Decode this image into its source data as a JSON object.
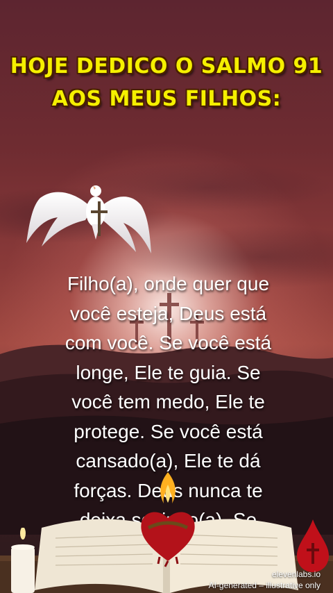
{
  "title": {
    "line1": "HOJE DEDICO O SALMO 91",
    "line2": "AOS MEUS FILHOS:"
  },
  "message": {
    "lines": [
      "Filho(a), onde quer que",
      "você esteja, Deus está",
      "com você. Se você está",
      "longe, Ele te guia. Se",
      "você tem medo, Ele te",
      "protege. Se você está",
      "cansado(a), Ele te dá",
      "forças. Deus nunca te",
      "deixa sozinho(a). Se"
    ]
  },
  "watermark": {
    "brand": "elevenlabs.io",
    "disclaimer": "AI-generated – illustrative only"
  },
  "colors": {
    "title_fill": "#f5f000",
    "title_outline": "#4a2000",
    "text": "#ffffff",
    "sky_top": "#5d2530",
    "sky_glow": "#fff0eb"
  },
  "icons": [
    "dove-icon",
    "cross-icon",
    "sacred-heart-icon",
    "candle-icon",
    "blood-drop-icon",
    "bible-icon"
  ]
}
